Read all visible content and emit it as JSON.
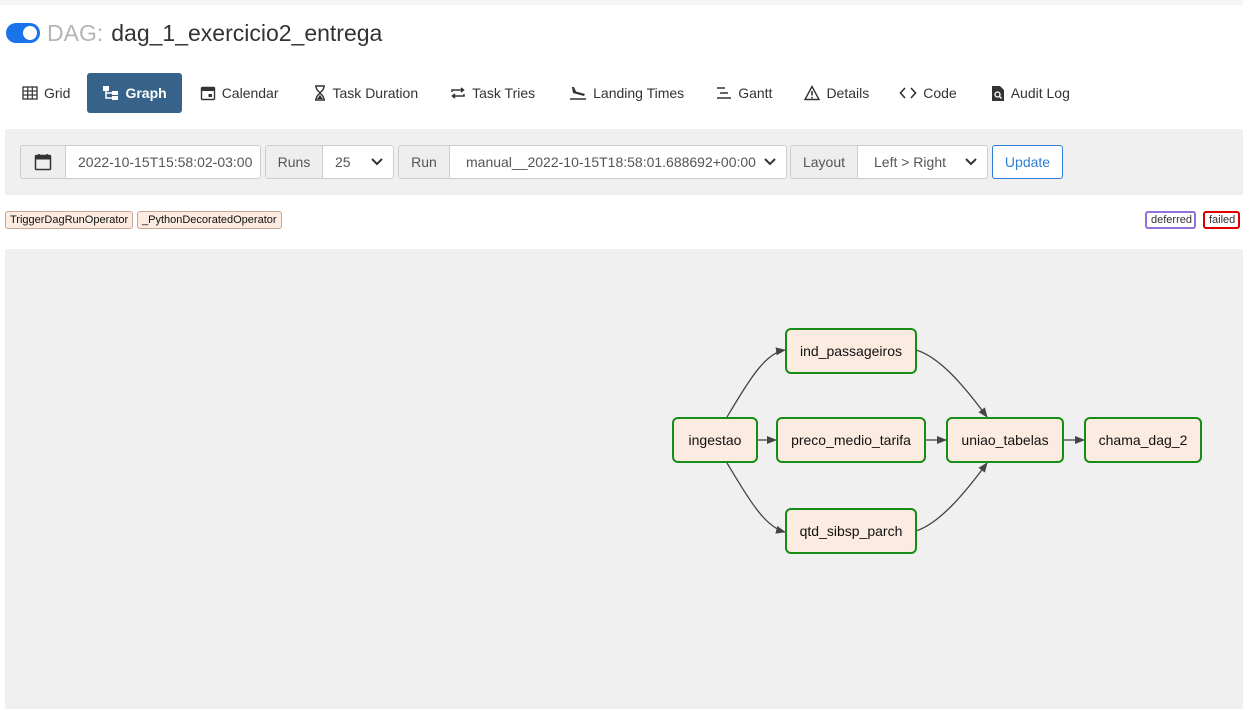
{
  "header": {
    "dag_prefix": "DAG:",
    "dag_name": "dag_1_exercicio2_entrega",
    "toggle_state": "on"
  },
  "nav": {
    "tabs": [
      {
        "label": "Grid",
        "icon": "grid-icon"
      },
      {
        "label": "Graph",
        "icon": "graph-icon",
        "active": true
      },
      {
        "label": "Calendar",
        "icon": "calendar-icon"
      },
      {
        "label": "Task Duration",
        "icon": "hourglass-icon"
      },
      {
        "label": "Task Tries",
        "icon": "repeat-icon"
      },
      {
        "label": "Landing Times",
        "icon": "landing-icon"
      },
      {
        "label": "Gantt",
        "icon": "gantt-icon"
      },
      {
        "label": "Details",
        "icon": "warning-triangle-icon"
      },
      {
        "label": "Code",
        "icon": "code-icon"
      },
      {
        "label": "Audit Log",
        "icon": "audit-log-icon"
      }
    ]
  },
  "filters": {
    "date_value": "2022-10-15T15:58:02-03:00",
    "runs_label": "Runs",
    "runs_value": "25",
    "run_label": "Run",
    "run_value": "manual__2022-10-15T18:58:01.688692+00:00",
    "layout_label": "Layout",
    "layout_value": "Left > Right",
    "update_label": "Update"
  },
  "legend": {
    "operators": [
      "TriggerDagRunOperator",
      "_PythonDecoratedOperator"
    ],
    "states": [
      {
        "label": "deferred",
        "color": "#9370db"
      },
      {
        "label": "failed",
        "color": "#dd0000"
      }
    ]
  },
  "colors": {
    "accent": "#37638a",
    "toggle": "#1a73e8",
    "node_fill": "#fcebe0",
    "node_border_success": "#168d16",
    "update_button": "#2f7ed8"
  },
  "graph": {
    "nodes": [
      {
        "id": "ingestao",
        "label": "ingestao"
      },
      {
        "id": "ind_passageiros",
        "label": "ind_passageiros"
      },
      {
        "id": "preco_medio_tarifa",
        "label": "preco_medio_tarifa"
      },
      {
        "id": "qtd_sibsp_parch",
        "label": "qtd_sibsp_parch"
      },
      {
        "id": "uniao_tabelas",
        "label": "uniao_tabelas"
      },
      {
        "id": "chama_dag_2",
        "label": "chama_dag_2"
      }
    ],
    "edges": [
      {
        "from": "ingestao",
        "to": "ind_passageiros"
      },
      {
        "from": "ingestao",
        "to": "preco_medio_tarifa"
      },
      {
        "from": "ingestao",
        "to": "qtd_sibsp_parch"
      },
      {
        "from": "ind_passageiros",
        "to": "uniao_tabelas"
      },
      {
        "from": "preco_medio_tarifa",
        "to": "uniao_tabelas"
      },
      {
        "from": "qtd_sibsp_parch",
        "to": "uniao_tabelas"
      },
      {
        "from": "uniao_tabelas",
        "to": "chama_dag_2"
      }
    ]
  }
}
